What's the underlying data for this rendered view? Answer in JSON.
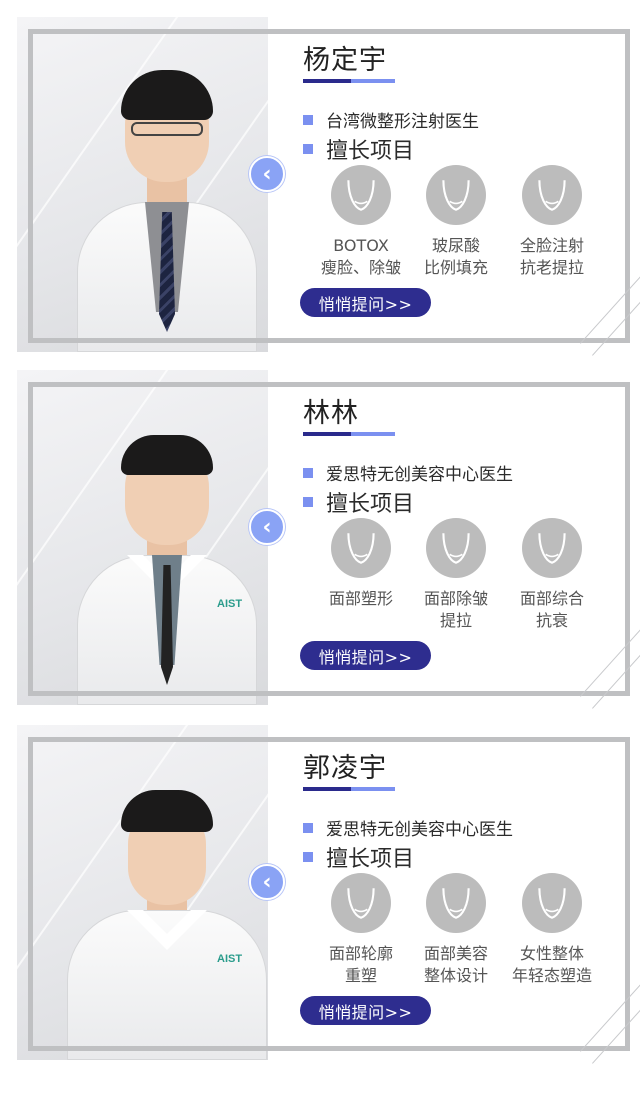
{
  "doctors": [
    {
      "name": "杨定宇",
      "title": "台湾微整形注射医生",
      "skills_heading": "擅长项目",
      "skills": [
        {
          "label": "BOTOX\n瘦脸、除皱",
          "icon": "face-contour-icon"
        },
        {
          "label": "玻尿酸\n比例填充",
          "icon": "face-contour-icon"
        },
        {
          "label": "全脸注射\n抗老提拉",
          "icon": "face-contour-icon"
        }
      ],
      "consult_label": "悄悄提问>>",
      "nav_icon": "chevron-left-icon"
    },
    {
      "name": "林林",
      "title": "爱思特无创美容中心医生",
      "skills_heading": "擅长项目",
      "skills": [
        {
          "label": "面部塑形",
          "icon": "face-contour-icon"
        },
        {
          "label": "面部除皱\n提拉",
          "icon": "face-contour-icon"
        },
        {
          "label": "面部综合\n抗衰",
          "icon": "face-contour-icon"
        }
      ],
      "consult_label": "悄悄提问>>",
      "nav_icon": "chevron-left-icon"
    },
    {
      "name": "郭凌宇",
      "title": "爱思特无创美容中心医生",
      "skills_heading": "擅长项目",
      "skills": [
        {
          "label": "面部轮廓\n重塑",
          "icon": "face-contour-icon"
        },
        {
          "label": "面部美容\n整体设计",
          "icon": "face-contour-icon"
        },
        {
          "label": "女性整体\n年轻态塑造",
          "icon": "face-contour-icon"
        }
      ],
      "consult_label": "悄悄提问>>",
      "nav_icon": "chevron-left-icon"
    }
  ],
  "clinic_logo_text": "AIST",
  "colors": {
    "accent": "#7b90f0",
    "button": "#2e2d8f",
    "frame": "#bfc0c2",
    "icon_bg": "#bcbcbc",
    "nav": "#8aa3f5"
  }
}
